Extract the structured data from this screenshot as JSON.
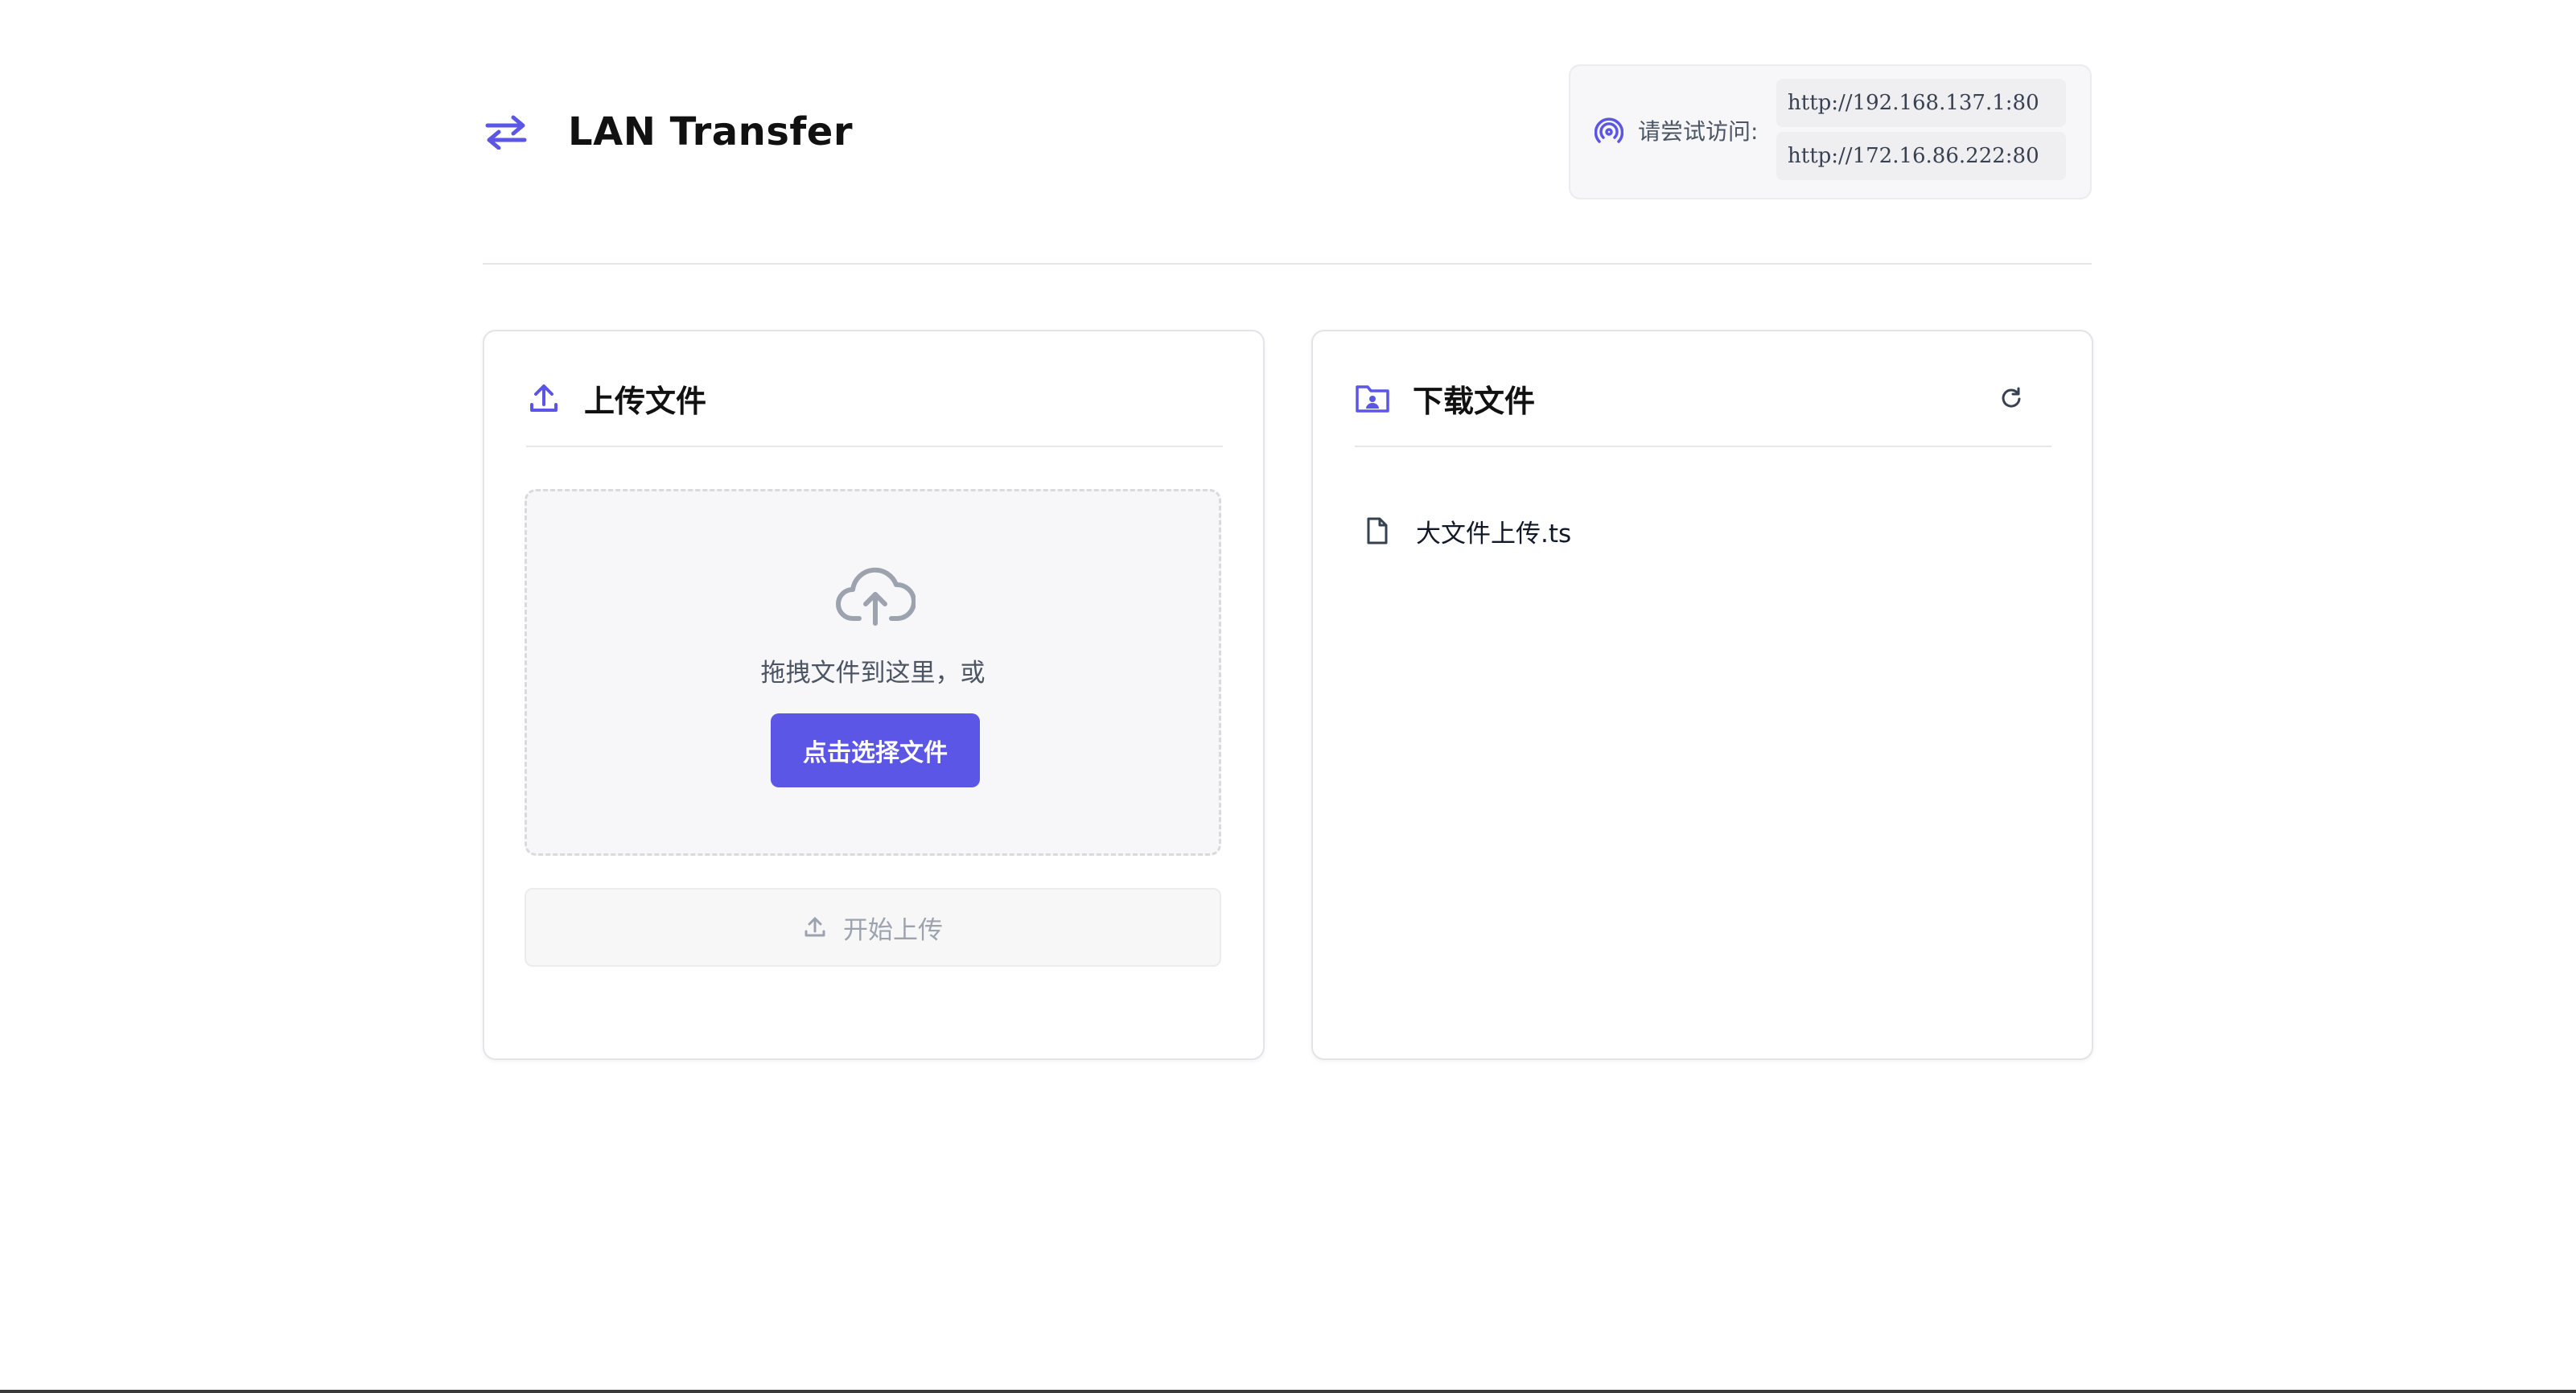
{
  "app": {
    "title": "LAN Transfer",
    "accent_color": "#5b56e5",
    "brand_icon": "swap-arrows-icon"
  },
  "access": {
    "icon": "broadcast-icon",
    "label": "请尝试访问:",
    "urls": [
      "http://192.168.137.1:80",
      "http://172.16.86.222:80"
    ]
  },
  "upload": {
    "icon": "upload-icon",
    "title": "上传文件",
    "dropzone": {
      "icon": "cloud-upload-icon",
      "text": "拖拽文件到这里，或",
      "choose_label": "点击选择文件"
    },
    "start_label": "开始上传",
    "start_icon": "upload-icon"
  },
  "download": {
    "icon": "folder-user-icon",
    "title": "下载文件",
    "refresh_icon": "refresh-icon",
    "files": [
      {
        "name": "大文件上传.ts",
        "icon": "file-icon"
      }
    ]
  }
}
